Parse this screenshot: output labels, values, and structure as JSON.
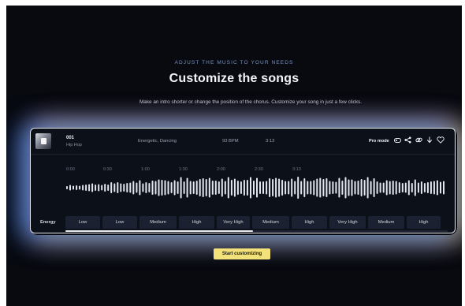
{
  "header": {
    "eyebrow": "ADJUST THE MUSIC TO YOUR NEEDS",
    "title": "Customize the songs",
    "subtitle": "Make an intro shorter or change the position of the chorus. Customize your song in just a few clicks."
  },
  "song": {
    "number": "001",
    "genre": "Hip Hop",
    "mood": "Energetic, Dancing",
    "bpm": "93 BPM",
    "duration": "3:13",
    "pro_mode_label": "Pro mode",
    "icons": [
      "toggle-icon",
      "share-icon",
      "link-icon",
      "download-icon",
      "heart-icon"
    ]
  },
  "timeline": {
    "labels": [
      "0:00",
      "0:30",
      "1:00",
      "1:30",
      "2:00",
      "2:30",
      "3:13"
    ]
  },
  "energy": {
    "label": "Energy",
    "segments": [
      "Low",
      "Low",
      "Medium",
      "High",
      "Very High",
      "Medium",
      "High",
      "Very High",
      "Medium",
      "High"
    ]
  },
  "playback": {
    "progress": 0.49
  },
  "cta": {
    "label": "Start customizing"
  },
  "colors": {
    "accent": "#f3e27a",
    "background": "#080a10",
    "eyebrow": "#7a93c6"
  }
}
